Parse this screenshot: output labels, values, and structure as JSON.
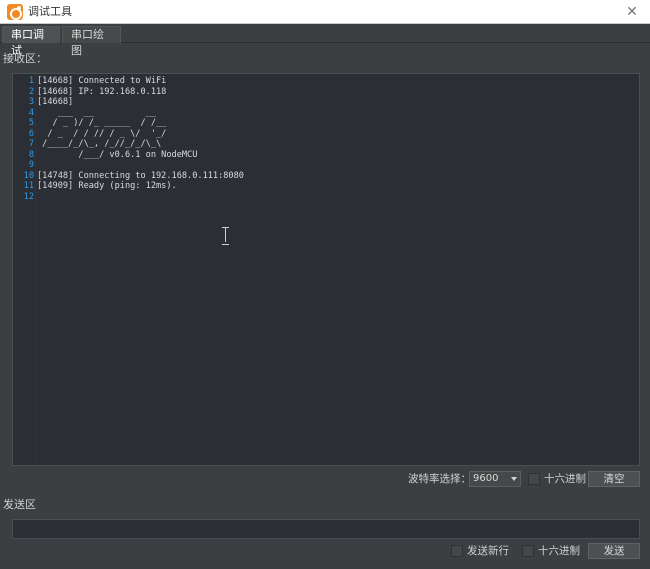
{
  "window": {
    "title": "调试工具"
  },
  "tabs": [
    {
      "label": "串口调试",
      "active": true
    },
    {
      "label": "串口绘图",
      "active": false
    }
  ],
  "receive": {
    "label": "接收区：",
    "lines": [
      {
        "num": "1",
        "text": "[14668] Connected to WiFi"
      },
      {
        "num": "2",
        "text": "[14668] IP: 192.168.0.118"
      },
      {
        "num": "3",
        "text": "[14668]"
      },
      {
        "num": "4",
        "text": "    ___  __          __"
      },
      {
        "num": "5",
        "text": "   / _ )/ /_ _____  / /__"
      },
      {
        "num": "6",
        "text": "  / _  / / // / _ \\/  '_/"
      },
      {
        "num": "7",
        "text": " /____/_/\\_, /_//_/_/\\_\\"
      },
      {
        "num": "8",
        "text": "        /___/ v0.6.1 on NodeMCU"
      },
      {
        "num": "9",
        "text": ""
      },
      {
        "num": "10",
        "text": "[14748] Connecting to 192.168.0.111:8080"
      },
      {
        "num": "11",
        "text": "[14909] Ready (ping: 12ms)."
      },
      {
        "num": "12",
        "text": ""
      }
    ]
  },
  "receive_controls": {
    "baud_label": "波特率选择：",
    "baud_value": "9600",
    "hex_label": "十六进制",
    "clear_label": "清空"
  },
  "send": {
    "label": "发送区",
    "input_value": "",
    "newline_label": "发送新行",
    "hex_label": "十六进制",
    "send_label": "发送"
  },
  "icons": {
    "app": "app-logo-icon",
    "close": "close-icon",
    "dropdown": "chevron-down-icon",
    "text_cursor": "text-cursor-icon"
  }
}
